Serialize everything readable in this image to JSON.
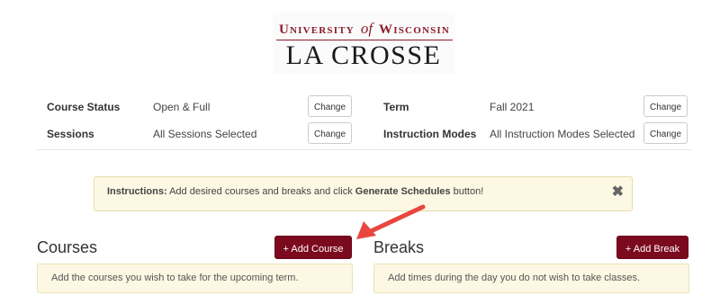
{
  "logo": {
    "line1_a": "University",
    "line1_of": "of",
    "line1_b": "Wisconsin",
    "line2": "LA CROSSE"
  },
  "filters": {
    "course_status": {
      "label": "Course Status",
      "value": "Open & Full",
      "button": "Change"
    },
    "term": {
      "label": "Term",
      "value": "Fall 2021",
      "button": "Change"
    },
    "sessions": {
      "label": "Sessions",
      "value": "All Sessions Selected",
      "button": "Change"
    },
    "instruction_modes": {
      "label": "Instruction Modes",
      "value": "All Instruction Modes Selected",
      "button": "Change"
    }
  },
  "alert": {
    "prefix": "Instructions:",
    "text_a": "Add desired courses and breaks and click",
    "emphasis": "Generate Schedules",
    "text_b": "button!",
    "close_glyph": "✖"
  },
  "courses": {
    "title": "Courses",
    "button": "+ Add Course",
    "hint": "Add the courses you wish to take for the upcoming term."
  },
  "breaks": {
    "title": "Breaks",
    "button": "+ Add Break",
    "hint": "Add times during the day you do not wish to take classes."
  },
  "colors": {
    "brand": "#7b0a1f",
    "alert_bg": "#fcf8e3",
    "annotation_arrow": "#e8473f"
  },
  "icons": {
    "close": "close-icon",
    "annotation": "arrow-annotation"
  }
}
